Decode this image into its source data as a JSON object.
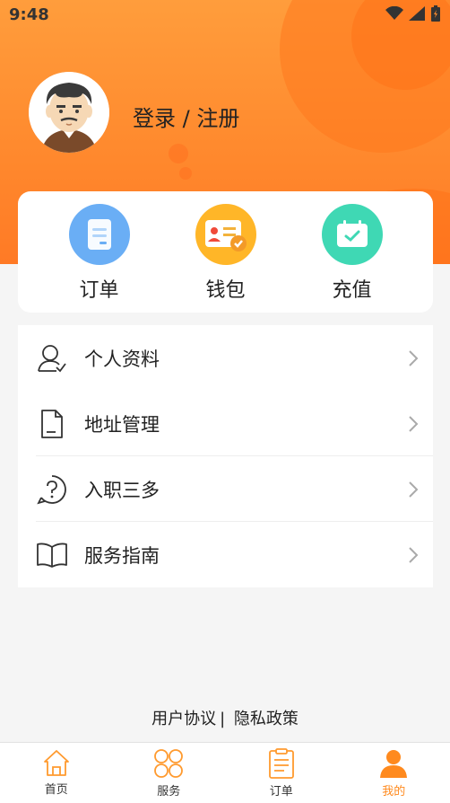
{
  "status_bar": {
    "time": "9:48"
  },
  "header": {
    "login_text": "登录 / 注册"
  },
  "quick_actions": [
    {
      "label": "订单",
      "icon": "order-doc-icon",
      "color": "#6aaef5"
    },
    {
      "label": "钱包",
      "icon": "wallet-card-icon",
      "color": "#ffb628"
    },
    {
      "label": "充值",
      "icon": "calendar-check-icon",
      "color": "#3fd8b4"
    }
  ],
  "menu": [
    {
      "label": "个人资料",
      "icon": "user-profile-icon"
    },
    {
      "label": "地址管理",
      "icon": "document-icon"
    },
    {
      "label": "入职三多",
      "icon": "question-circle-icon"
    },
    {
      "label": "服务指南",
      "icon": "book-icon"
    }
  ],
  "footer": {
    "user_agreement": "用户协议",
    "separator": "|",
    "privacy_policy": "隐私政策"
  },
  "tabbar": [
    {
      "label": "首页",
      "icon": "home-icon",
      "active": false
    },
    {
      "label": "服务",
      "icon": "grid-icon",
      "active": false
    },
    {
      "label": "订单",
      "icon": "clipboard-icon",
      "active": false
    },
    {
      "label": "我的",
      "icon": "person-icon",
      "active": true
    }
  ],
  "colors": {
    "accent": "#ff8a1e",
    "header": "#ff8a2e"
  }
}
